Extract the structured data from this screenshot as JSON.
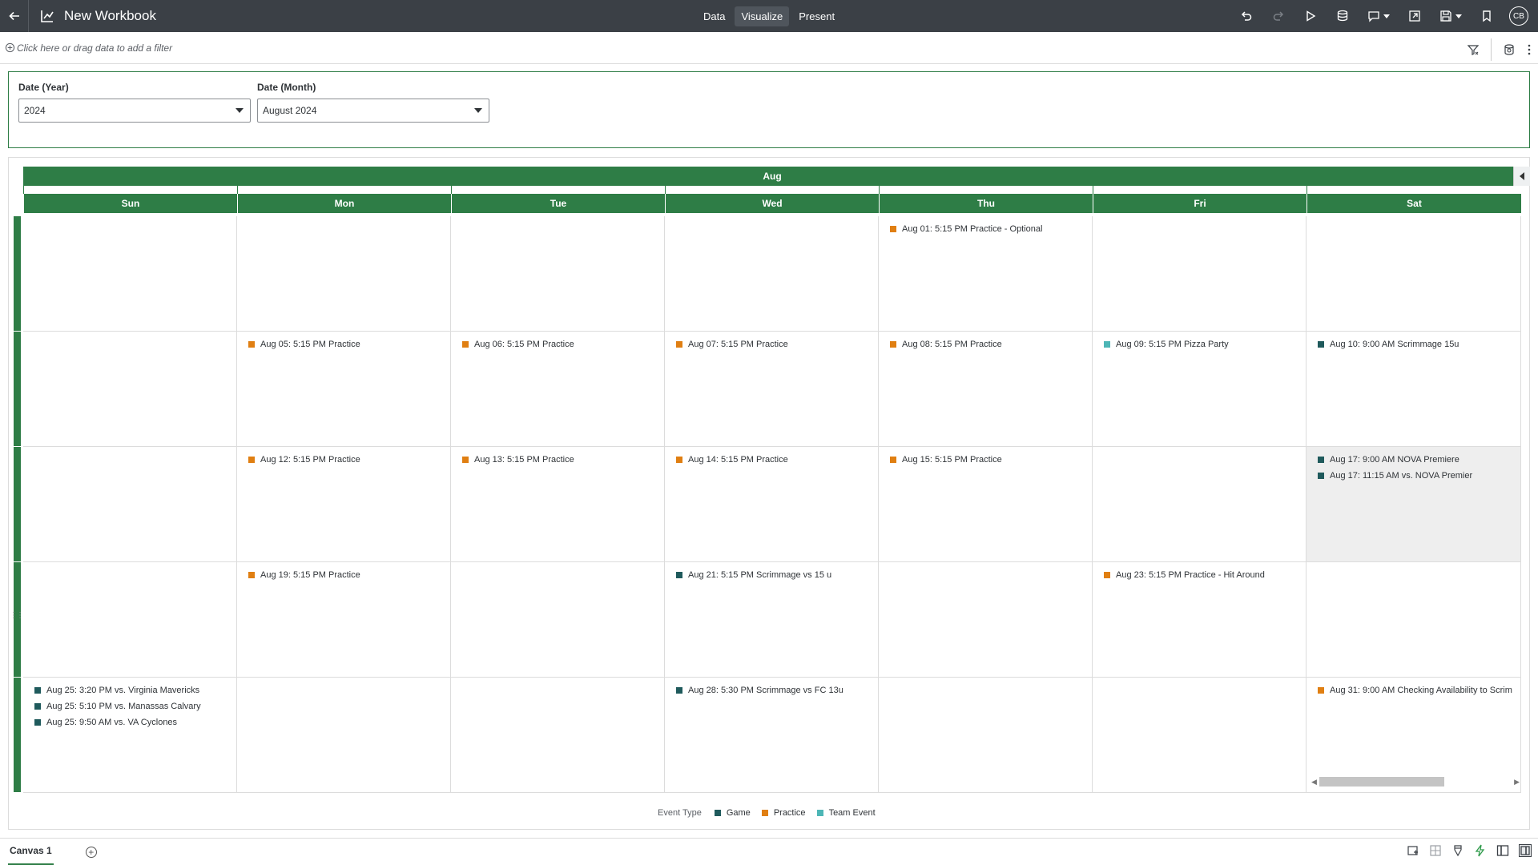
{
  "app": {
    "title": "New Workbook",
    "tabs": [
      "Data",
      "Visualize",
      "Present"
    ],
    "active_tab": "Visualize",
    "user_initials": "CB"
  },
  "filter_bar": {
    "add_filter_text": "Click here or drag data to add a filter"
  },
  "filters": [
    {
      "label": "Date (Year)",
      "value": "2024"
    },
    {
      "label": "Date (Month)",
      "value": "August 2024"
    }
  ],
  "calendar": {
    "month": "Aug",
    "days": [
      "Sun",
      "Mon",
      "Tue",
      "Wed",
      "Thu",
      "Fri",
      "Sat"
    ],
    "weeks": [
      [
        [],
        [],
        [],
        [],
        [
          {
            "text": "Aug 01: 5:15 PM Practice - Optional",
            "type": "Practice"
          }
        ],
        [],
        []
      ],
      [
        [],
        [
          {
            "text": "Aug 05: 5:15 PM Practice",
            "type": "Practice"
          }
        ],
        [
          {
            "text": "Aug 06: 5:15 PM Practice",
            "type": "Practice"
          }
        ],
        [
          {
            "text": "Aug 07: 5:15 PM Practice",
            "type": "Practice"
          }
        ],
        [
          {
            "text": "Aug 08: 5:15 PM Practice",
            "type": "Practice"
          }
        ],
        [
          {
            "text": "Aug 09: 5:15 PM Pizza Party",
            "type": "Team Event"
          }
        ],
        [
          {
            "text": "Aug 10: 9:00 AM Scrimmage 15u",
            "type": "Game"
          }
        ]
      ],
      [
        [],
        [
          {
            "text": "Aug 12: 5:15 PM Practice",
            "type": "Practice"
          }
        ],
        [
          {
            "text": "Aug 13: 5:15 PM Practice",
            "type": "Practice"
          }
        ],
        [
          {
            "text": "Aug 14: 5:15 PM Practice",
            "type": "Practice"
          }
        ],
        [
          {
            "text": "Aug 15: 5:15 PM Practice",
            "type": "Practice"
          }
        ],
        [],
        [
          {
            "text": "Aug 17: 9:00 AM NOVA Premiere",
            "type": "Game"
          },
          {
            "text": "Aug 17: 11:15 AM vs. NOVA Premier",
            "type": "Game"
          }
        ]
      ],
      [
        [],
        [
          {
            "text": "Aug 19: 5:15 PM Practice",
            "type": "Practice"
          }
        ],
        [],
        [
          {
            "text": "Aug 21: 5:15 PM Scrimmage vs 15 u",
            "type": "Game"
          }
        ],
        [],
        [
          {
            "text": "Aug 23: 5:15 PM Practice - Hit Around",
            "type": "Practice"
          }
        ],
        []
      ],
      [
        [
          {
            "text": "Aug 25: 3:20 PM vs. Virginia Mavericks",
            "type": "Game"
          },
          {
            "text": "Aug 25: 5:10 PM vs. Manassas Calvary",
            "type": "Game"
          },
          {
            "text": "Aug 25: 9:50 AM vs. VA Cyclones",
            "type": "Game"
          }
        ],
        [],
        [],
        [
          {
            "text": "Aug 28: 5:30 PM Scrimmage vs FC 13u",
            "type": "Game"
          }
        ],
        [],
        [],
        [
          {
            "text": "Aug 31: 9:00 AM Checking Availability to Scrim",
            "type": "Practice"
          }
        ]
      ]
    ]
  },
  "legend": {
    "title": "Event Type",
    "items": [
      {
        "label": "Game",
        "color": "#1f5a5c"
      },
      {
        "label": "Practice",
        "color": "#e07f12"
      },
      {
        "label": "Team Event",
        "color": "#4db6b6"
      }
    ]
  },
  "colors": {
    "accent": "#2e7d46",
    "topbar": "#3b4046"
  },
  "bottom": {
    "canvas_tab": "Canvas 1"
  }
}
